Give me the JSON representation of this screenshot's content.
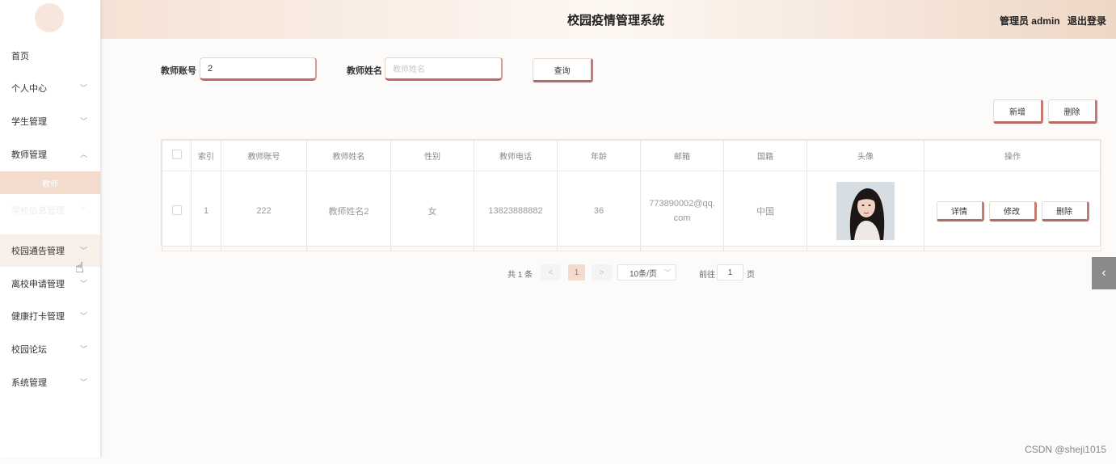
{
  "header": {
    "title": "校园疫情管理系统",
    "user_label": "管理员 admin",
    "logout": "退出登录"
  },
  "sidebar": {
    "items": [
      {
        "label": "首页"
      },
      {
        "label": "个人中心"
      },
      {
        "label": "学生管理"
      },
      {
        "label": "教师管理"
      },
      {
        "label": "教师"
      },
      {
        "label": "学校信息管理"
      },
      {
        "label": "校园通告管理"
      },
      {
        "label": "离校申请管理"
      },
      {
        "label": "健康打卡管理"
      },
      {
        "label": "校园论坛"
      },
      {
        "label": "系统管理"
      }
    ]
  },
  "search": {
    "account_label": "教师账号",
    "account_value": "2",
    "name_label": "教师姓名",
    "name_placeholder": "教师姓名",
    "query_button": "查询"
  },
  "actions": {
    "add": "新增",
    "delete": "删除"
  },
  "table": {
    "columns": [
      "索引",
      "教师账号",
      "教师姓名",
      "性别",
      "教师电话",
      "年龄",
      "邮箱",
      "国籍",
      "头像",
      "操作"
    ],
    "rows": [
      {
        "index": "1",
        "account": "222",
        "name": "教师姓名2",
        "gender": "女",
        "phone": "13823888882",
        "age": "36",
        "email": "773890002@qq.com",
        "country": "中国",
        "ops": {
          "detail": "详情",
          "edit": "修改",
          "delete": "删除"
        }
      }
    ]
  },
  "pagination": {
    "total": "共 1 条",
    "prev": "<",
    "current": "1",
    "next": ">",
    "page_size": "10条/页",
    "goto_label": "前往",
    "goto_value": "1",
    "page_unit": "页"
  },
  "watermark": "CSDN @sheji1015",
  "colors": {
    "accent": "#c06c62",
    "header_gradient_start": "#f5e2d5",
    "header_gradient_end": "#eed7c6",
    "active_submenu": "#f3dccd"
  },
  "icons": {
    "chevron": "chevron-down-icon",
    "side_toggle": "chevron-left-icon"
  }
}
